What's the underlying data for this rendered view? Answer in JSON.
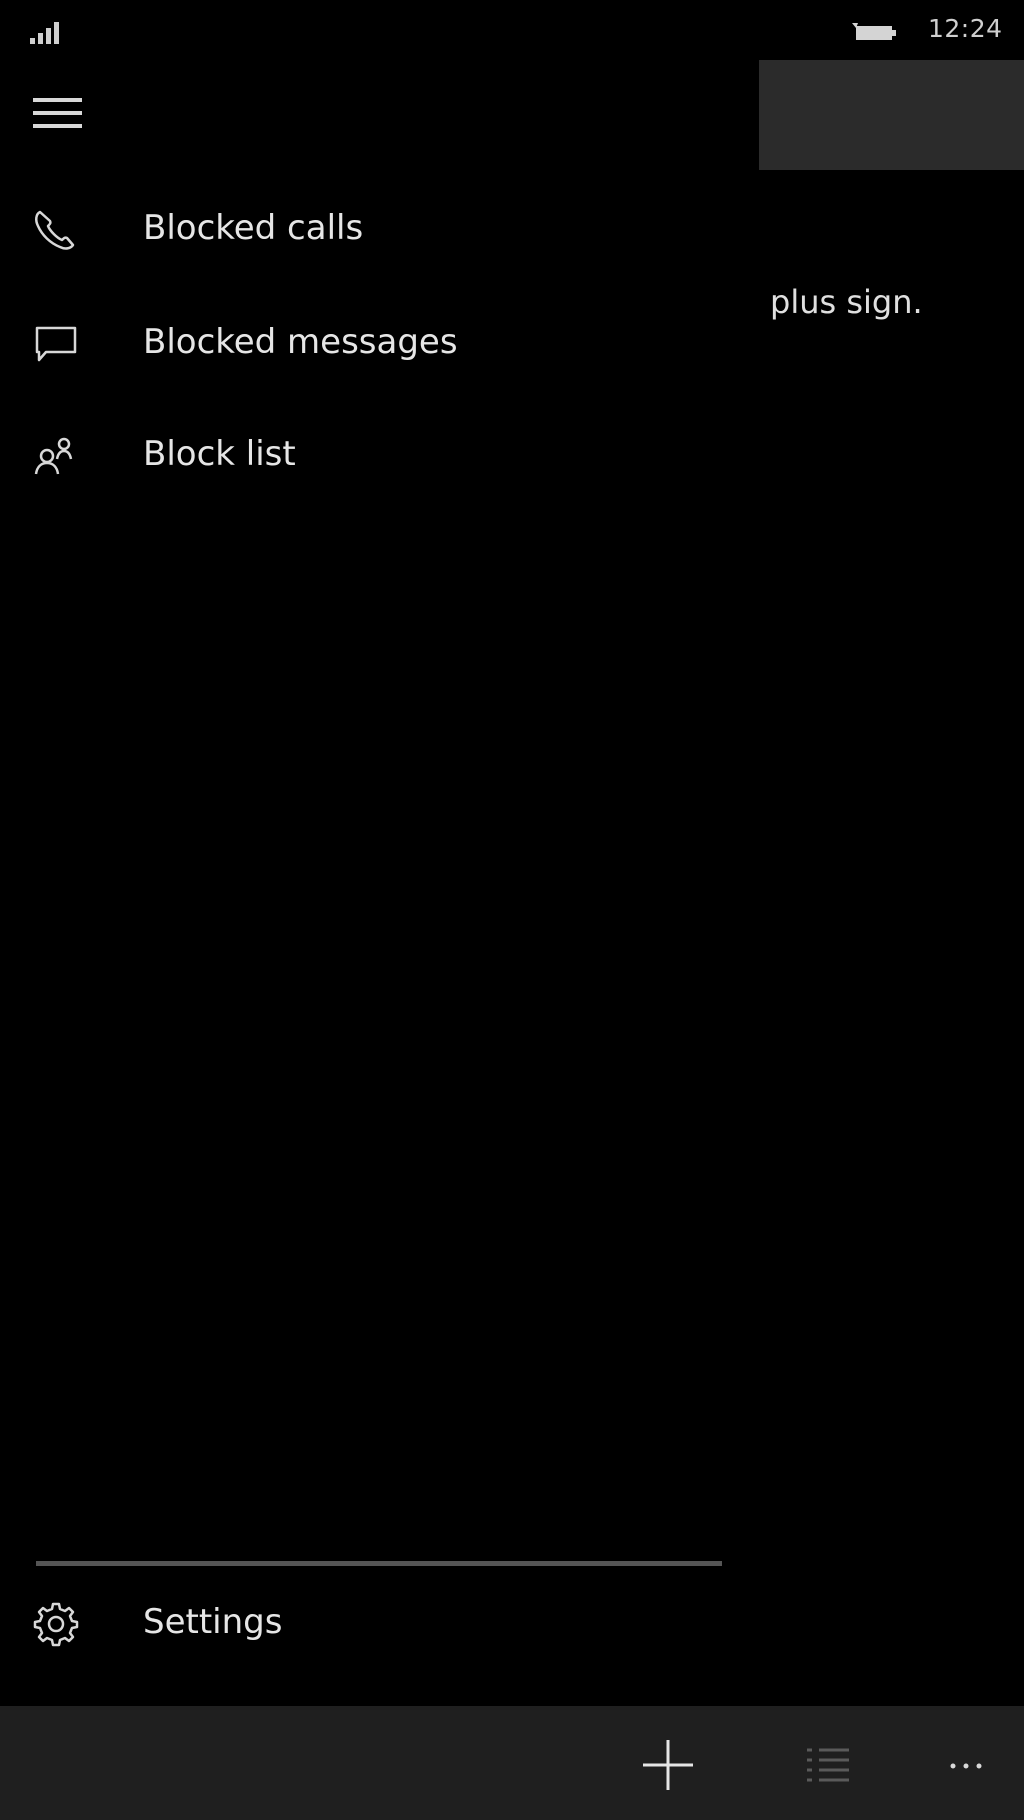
{
  "status_bar": {
    "time": "12:24",
    "signal_icon": "signal-strength-icon",
    "battery_icon": "battery-icon"
  },
  "background_page": {
    "visible_text": "plus sign."
  },
  "nav_pane": {
    "menu_icon": "hamburger-menu-icon",
    "items": [
      {
        "label": "Blocked calls",
        "icon": "phone-icon"
      },
      {
        "label": "Blocked messages",
        "icon": "message-icon"
      },
      {
        "label": "Block list",
        "icon": "block-list-icon"
      }
    ],
    "footer_items": [
      {
        "label": "Settings",
        "icon": "gear-icon"
      }
    ]
  },
  "app_bar": {
    "buttons": [
      {
        "name": "add",
        "icon": "plus-icon",
        "enabled": true
      },
      {
        "name": "select",
        "icon": "list-select-icon",
        "enabled": false
      },
      {
        "name": "more",
        "icon": "more-icon",
        "enabled": true
      }
    ]
  },
  "colors": {
    "background": "#000000",
    "pane_divider": "#555555",
    "app_bar": "#1f1f1f",
    "header_block": "#2b2b2b",
    "text": "#e6e6e6",
    "disabled_icon": "#5a5a5a"
  }
}
